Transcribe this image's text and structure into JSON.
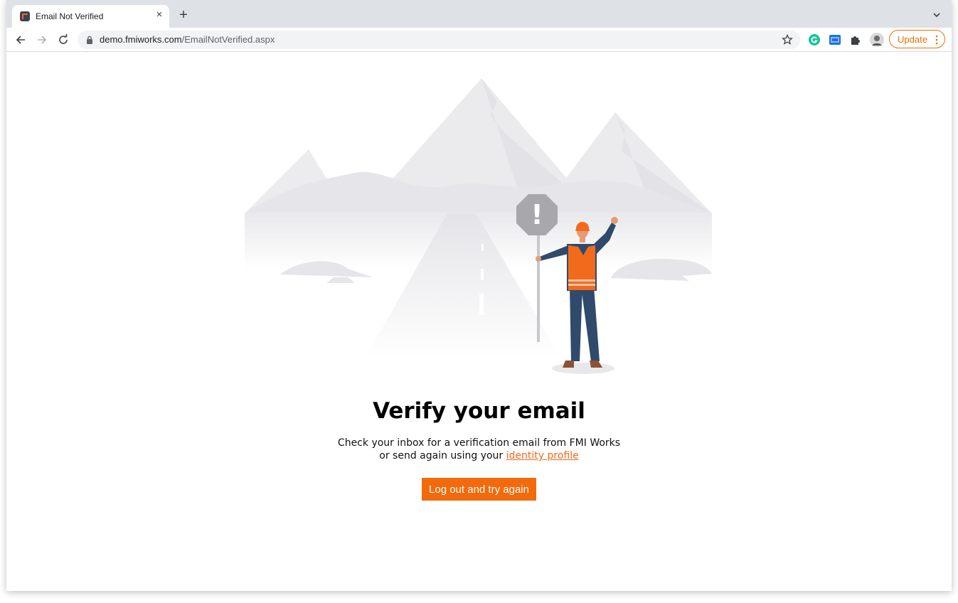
{
  "browser": {
    "tab_title": "Email Not Verified",
    "new_tab_symbol": "+",
    "close_symbol": "×",
    "url_domain": "demo.fmiworks.com",
    "url_path": "/EmailNotVerified.aspx",
    "update_label": "Update",
    "extensions": [
      "grammarly-icon",
      "cookie-editor-icon",
      "puzzle-extensions-icon",
      "profile-avatar"
    ]
  },
  "page": {
    "heading": "Verify your email",
    "line1": "Check your inbox for a verification email from FMI Works",
    "line2_prefix": "or send again using your ",
    "line2_link": "identity profile",
    "button_label": "Log out and try again",
    "sign_symbol": "!"
  },
  "colors": {
    "accent": "#f26a0c",
    "update": "#e8710a",
    "mountains": "#e9e9ec"
  }
}
